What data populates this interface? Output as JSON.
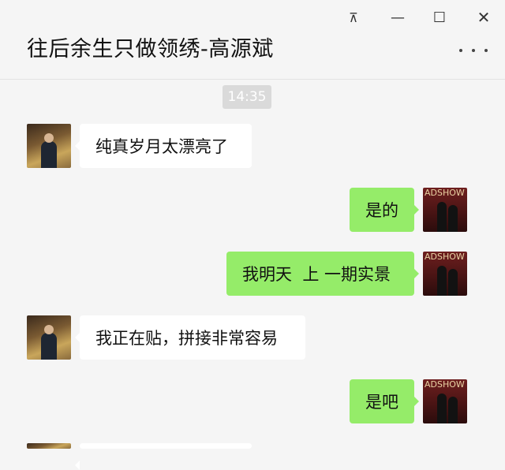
{
  "header": {
    "title": "往后余生只做领绣-高源斌",
    "pin_icon": "pin-icon",
    "minimize_glyph": "—",
    "maximize_glyph": "☐",
    "close_glyph": "✕",
    "pin_glyph": "⊼"
  },
  "timestamp": "14:35",
  "messages": [
    {
      "side": "in",
      "text": "纯真岁月太漂亮了"
    },
    {
      "side": "out",
      "text": "是的"
    },
    {
      "side": "out",
      "text": "我明天  上 一期实景"
    },
    {
      "side": "in",
      "text": "我正在贴，拼接非常容易"
    },
    {
      "side": "out",
      "text": "是吧"
    }
  ],
  "avatar_brand_text": "ADSHOW",
  "colors": {
    "incoming_bubble": "#ffffff",
    "outgoing_bubble": "#95ec69",
    "background": "#f5f5f5"
  }
}
